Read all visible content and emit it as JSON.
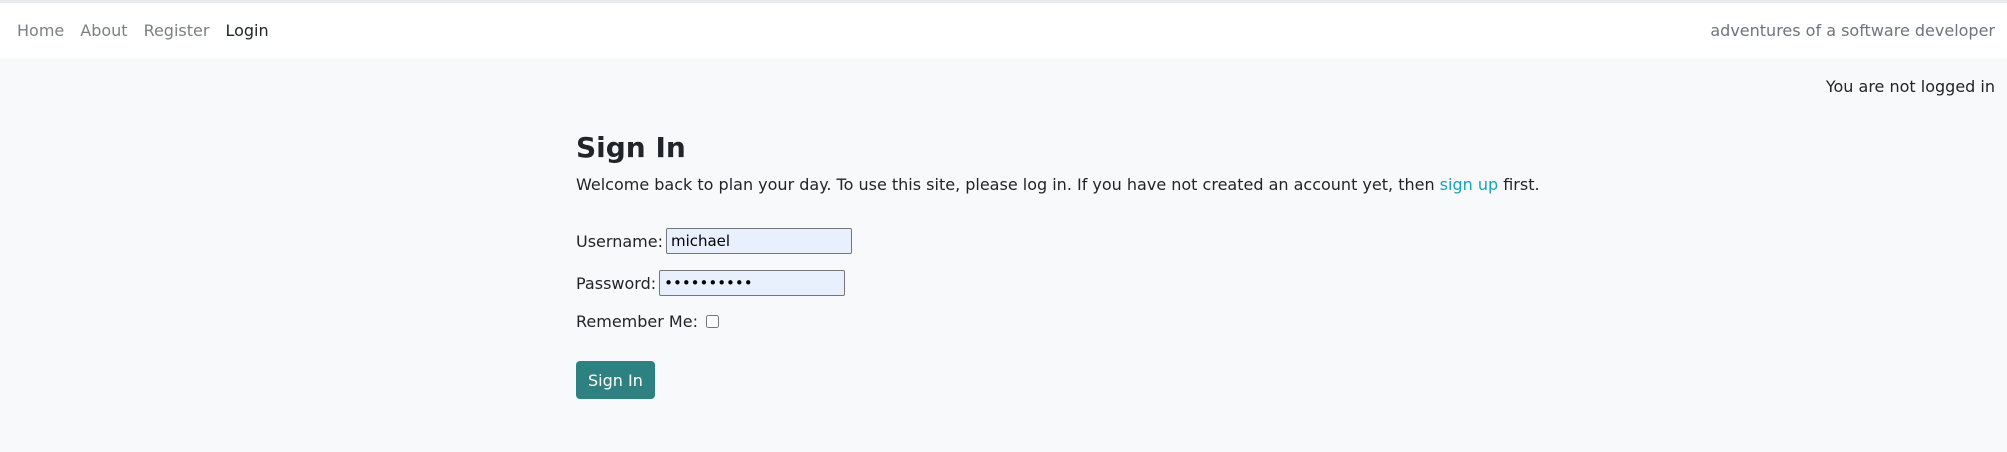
{
  "nav": {
    "links": [
      "Home",
      "About",
      "Register",
      "Login"
    ],
    "active_index": 3,
    "brand": "adventures of a software developer"
  },
  "status": {
    "text": "You are not logged in"
  },
  "signin": {
    "title": "Sign In",
    "intro_before": "Welcome back to plan your day. To use this site, please log in. If you have not created an account yet, then ",
    "signup_link": "sign up",
    "intro_after": " first.",
    "username_label": "Username:",
    "username_value": "michael",
    "password_label": "Password:",
    "password_value": "••••••••••",
    "remember_label": "Remember Me:",
    "remember_checked": false,
    "submit_label": "Sign In"
  },
  "colors": {
    "accent": "#2e8181",
    "link": "#17a2b8",
    "page_bg": "#f8f9fa"
  }
}
